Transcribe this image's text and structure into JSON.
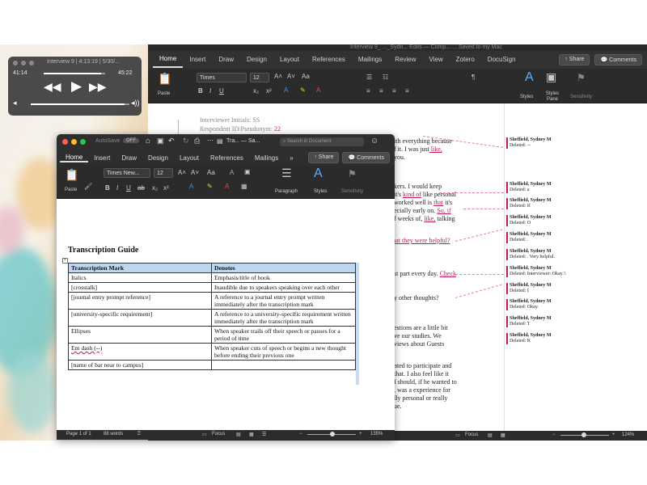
{
  "player": {
    "title": "Interview 9 | 4:13:19 | 5/30/...",
    "elapsed": "41:14",
    "remaining": "45:22",
    "progress": 0.93,
    "volume": 0.95
  },
  "back_window": {
    "title": "Interview 9_ ..._Sydn... Edits — Comp... ... Saved to my Mac",
    "tabs": [
      "Home",
      "Insert",
      "Draw",
      "Design",
      "Layout",
      "References",
      "Mailings",
      "Review",
      "View",
      "Zotero",
      "DocuSign"
    ],
    "share_label": "Share",
    "comments_label": "Comments",
    "font_name": "Times",
    "font_size": "12",
    "paste_label": "Paste",
    "styles_label": "Styles",
    "styles_pane_label": "Styles Pane",
    "sensitivity_label": "Sensitivity",
    "zoom": "124%",
    "focus_label": "Focus",
    "doc": {
      "header1": "Interviewer Initials: SS",
      "header2a": "Respondent ID/Pseudonym: ",
      "header2b": "22",
      "lines": [
        {
          "pre": "ith everything because",
          "ins": ""
        },
        {
          "pre": "f it. I was just",
          "ins": " like,"
        },
        {
          "pre": " you.",
          "ins": ""
        },
        {
          "pre": "kers. I would keep",
          "ins": ""
        },
        {
          "pre": "it's ",
          "ins": "kind of",
          "post": " like personal"
        },
        {
          "pre": "worked well is ",
          "ins": "that",
          "post": " it's"
        },
        {
          "pre": "ecially early on. ",
          "ins": "So, if"
        },
        {
          "pre": "f weeks of, ",
          "ins": "like,",
          "post": " talking"
        },
        {
          "pre": "",
          "ins": " that they were helpful?"
        },
        {
          "pre": "st part every day. ",
          "ins": "Check"
        },
        {
          "pre": "y other thoughts?",
          "ins": ""
        },
        {
          "pre": "estions are a little bit",
          "ins": ""
        },
        {
          "pre": "ve our studies. We",
          "ins": ""
        },
        {
          "pre": "views about Guests",
          "ins": ""
        },
        {
          "pre": "nted to participate and",
          "ins": ""
        },
        {
          "pre": "that. I also feel like it",
          "ins": ""
        },
        {
          "pre": "I should, if he wanted to",
          "ins": ""
        },
        {
          "pre": ", was a experience for",
          "ins": ""
        },
        {
          "pre": "lly personal or really",
          "ins": ""
        },
        {
          "pre": "ue.",
          "ins": ""
        }
      ],
      "comments": [
        {
          "author": "Sheffield, Sydney M",
          "text": "Deleted: --"
        },
        {
          "author": "Sheffield, Sydney M",
          "text": "Deleted:  a"
        },
        {
          "author": "Sheffield, Sydney M",
          "text": "Deleted: If"
        },
        {
          "author": "Sheffield, Sydney M",
          "text": "Deleted: O"
        },
        {
          "author": "Sheffield, Sydney M",
          "text": "Deleted: ."
        },
        {
          "author": "Sheffield, Sydney M",
          "text": "Deleted: . Very helpful."
        },
        {
          "author": "Sheffield, Sydney M",
          "text": "Deleted: Interviewer: Okay.",
          "ins": "5"
        },
        {
          "author": "Sheffield, Sydney M",
          "text": "Deleted: I"
        },
        {
          "author": "Sheffield, Sydney M",
          "text": "Deleted:  Okay."
        },
        {
          "author": "Sheffield, Sydney M",
          "text": "Deleted: T"
        },
        {
          "author": "Sheffield, Sydney M",
          "text": "Deleted:  K"
        }
      ]
    }
  },
  "front_window": {
    "autosave_label": "AutoSave",
    "autosave_state": "OFF",
    "title": "Tra... — Sa...",
    "search_placeholder": "Search in Document",
    "tabs": [
      "Home",
      "Insert",
      "Draw",
      "Design",
      "Layout",
      "References",
      "Mailings"
    ],
    "more_tabs": "»",
    "share_label": "Share",
    "comments_label": "Comments",
    "font_name": "Times New...",
    "font_size": "12",
    "paste_label": "Paste",
    "paragraph_label": "Paragraph",
    "styles_label": "Styles",
    "sensitivity_label": "Sensitivity",
    "page_info": "Page 1 of 1",
    "word_count": "88 words",
    "focus_label": "Focus",
    "zoom": "135%",
    "guide_title": "Transcription Guide",
    "table_headers": [
      "Transcription Mark",
      "Denotes"
    ],
    "rows": [
      [
        "Italics",
        "Emphasis/title of book"
      ],
      [
        "[crosstalk]",
        "Inaudible due to speakers speaking over each other"
      ],
      [
        "[journal entry prompt reference]",
        "A reference to a journal entry prompt written immediately after the transcription mark"
      ],
      [
        "[university-specific requirement]",
        "A reference to a university-specific requirement written immediately after the transcription mark"
      ],
      [
        "Ellipses",
        "When speaker trails off their speech or pauses for a period of time"
      ],
      [
        "Em dash (--)",
        "When speaker cuts of speech or begins a new thought before ending their previous one"
      ],
      [
        "[name of bar near to campus]",
        ""
      ]
    ]
  },
  "colors": {
    "accent_pink": "#c2185b",
    "table_header": "#bdd7ee",
    "chrome_dark": "#2e2e2e"
  }
}
